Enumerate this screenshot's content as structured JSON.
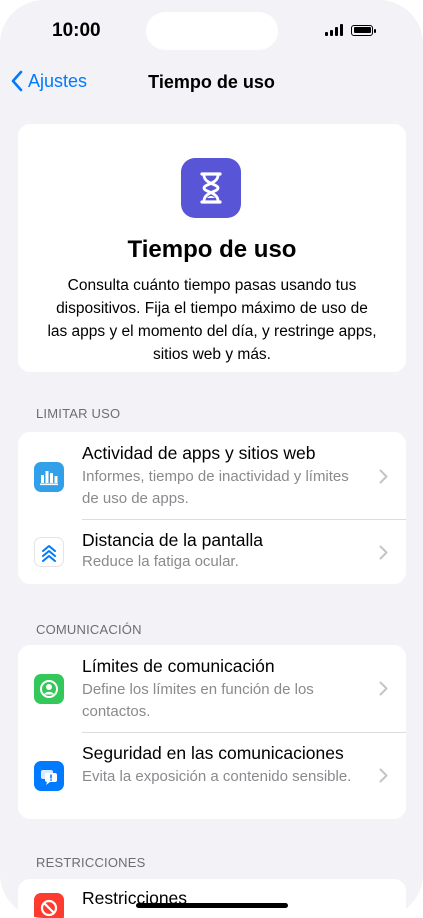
{
  "status": {
    "time": "10:00"
  },
  "nav": {
    "back_label": "Ajustes",
    "title": "Tiempo de uso"
  },
  "hero": {
    "title": "Tiempo de uso",
    "description": "Consulta cuánto tiempo pasas usando tus dispositivos. Fija el tiempo máximo de uso de las apps y el momento del día, y restringe apps, sitios web y más.",
    "icon": "hourglass-icon",
    "icon_color": "#5856d6"
  },
  "sections": [
    {
      "header": "LIMITAR USO",
      "rows": [
        {
          "title": "Actividad de apps y sitios web",
          "subtitle": "Informes, tiempo de inactividad y límites de uso de apps.",
          "icon": "bar-chart-icon",
          "icon_color": "#32a0e8"
        },
        {
          "title": "Distancia de la pantalla",
          "subtitle": "Reduce la fatiga ocular.",
          "icon": "chevrons-up-icon",
          "icon_color": "#ffffff"
        }
      ]
    },
    {
      "header": "COMUNICACIÓN",
      "rows": [
        {
          "title": "Límites de comunicación",
          "subtitle": "Define los límites en función de los contactos.",
          "icon": "person-circle-icon",
          "icon_color": "#34c759"
        },
        {
          "title": "Seguridad en las comunicaciones",
          "subtitle": "Evita la exposición a contenido sensible.",
          "icon": "chat-alert-icon",
          "icon_color": "#007aff"
        }
      ]
    },
    {
      "header": "RESTRICCIONES",
      "rows": [
        {
          "title": "Restricciones",
          "subtitle": "",
          "icon": "restrict-icon",
          "icon_color": "#ff3b30"
        }
      ]
    }
  ]
}
